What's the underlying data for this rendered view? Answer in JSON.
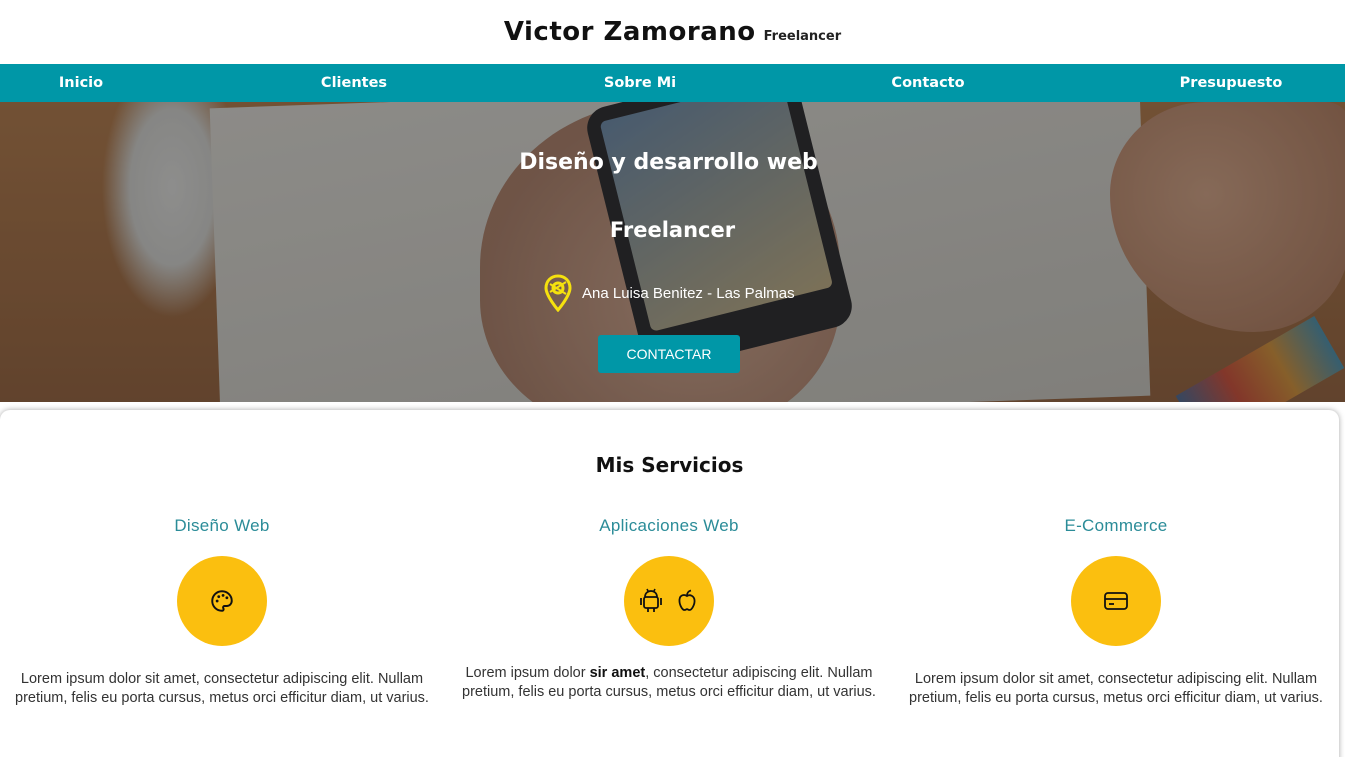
{
  "header": {
    "name": "Victor Zamorano",
    "role": "Freelancer"
  },
  "nav": {
    "items": [
      "Inicio",
      "Clientes",
      "Sobre Mi",
      "Contacto",
      "Presupuesto"
    ]
  },
  "hero": {
    "title": "Diseño y desarrollo web",
    "subtitle": "Freelancer",
    "location": "Ana Luisa Benitez - Las Palmas",
    "cta_label": "CONTACTAR",
    "location_icon": "map-pin-icon"
  },
  "services": {
    "title": "Mis Servicios",
    "items": [
      {
        "title": "Diseño Web",
        "icon": "palette-icon",
        "text": "Lorem ipsum dolor sit amet, consectetur adipiscing elit. Nullam pretium, felis eu porta cursus, metus orci efficitur diam, ut varius."
      },
      {
        "title": "Aplicaciones Web",
        "icon": "android-apple-icons",
        "text_before": "Lorem ipsum dolor ",
        "text_bold": "sir amet",
        "text_after": ", consectetur adipiscing elit. Nullam pretium, felis eu porta cursus, metus orci efficitur diam, ut varius."
      },
      {
        "title": "E-Commerce",
        "icon": "credit-card-icon",
        "text": "Lorem ipsum dolor sit amet, consectetur adipiscing elit. Nullam pretium, felis eu porta cursus, metus orci efficitur diam, ut varius."
      }
    ]
  },
  "colors": {
    "accent": "#0097a7",
    "icon_circle": "#fbbf0f",
    "service_title": "#2b8c98"
  }
}
